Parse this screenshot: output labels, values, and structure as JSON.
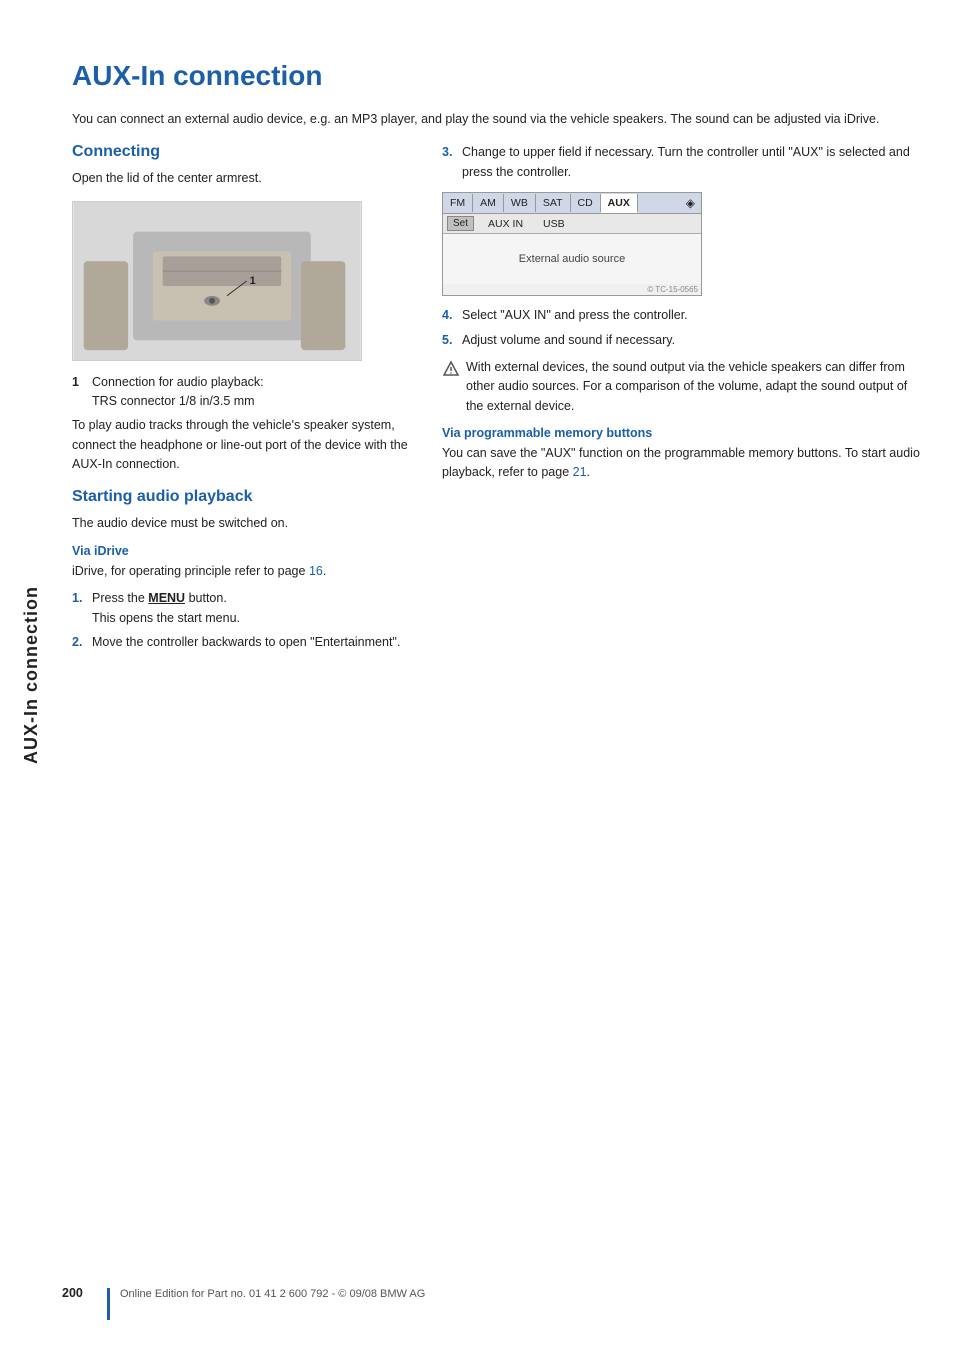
{
  "sidebar": {
    "label": "AUX-In connection"
  },
  "page": {
    "title": "AUX-In connection",
    "intro": "You can connect an external audio device, e.g. an MP3 player, and play the sound via the vehicle speakers. The sound can be adjusted via iDrive.",
    "connecting_heading": "Connecting",
    "connecting_text": "Open the lid of the center armrest.",
    "numbered_item_num": "1",
    "numbered_item_label": "Connection for audio playback:\nTRS connector 1/8 in/3.5 mm",
    "numbered_item_desc": "To play audio tracks through the vehicle's speaker system, connect the headphone or line-out port of the device with the AUX-In connection.",
    "starting_heading": "Starting audio playback",
    "starting_text": "The audio device must be switched on.",
    "via_idrive_heading": "Via iDrive",
    "via_idrive_text": "iDrive, for operating principle refer to page ",
    "via_idrive_page": "16",
    "step1_num": "1.",
    "step1_text": "Press the ",
    "step1_menu": "MENU",
    "step1_rest": " button.\nThis opens the start menu.",
    "step2_num": "2.",
    "step2_text": "Move the controller backwards to open \"Entertainment\".",
    "step3_num": "3.",
    "step3_text": "Change to upper field if necessary. Turn the controller until \"AUX\" is selected and press the controller.",
    "step4_num": "4.",
    "step4_text": "Select \"AUX IN\" and press the controller.",
    "step5_num": "5.",
    "step5_text": "Adjust volume and sound if necessary.",
    "note_text": "With external devices, the sound output via the vehicle speakers can differ from other audio sources. For a comparison of the volume, adapt the sound output of the external device.",
    "via_programmable_heading": "Via programmable memory buttons",
    "via_programmable_text": "You can save the \"AUX\" function on the programmable memory buttons. To start audio playback, refer to page ",
    "via_programmable_page": "21",
    "ui": {
      "tabs": [
        "FM",
        "AM",
        "WB",
        "SAT",
        "CD",
        "AUX"
      ],
      "active_tab": "AUX",
      "submenu": [
        "AUX IN",
        "USB"
      ],
      "set_btn": "Set",
      "body_text": "External audio source",
      "icon": "◈",
      "watermark": "© TC-15-0565"
    },
    "footer_page": "200",
    "footer_text": "Online Edition for Part no. 01 41 2 600 792 - © 09/08 BMW AG"
  }
}
